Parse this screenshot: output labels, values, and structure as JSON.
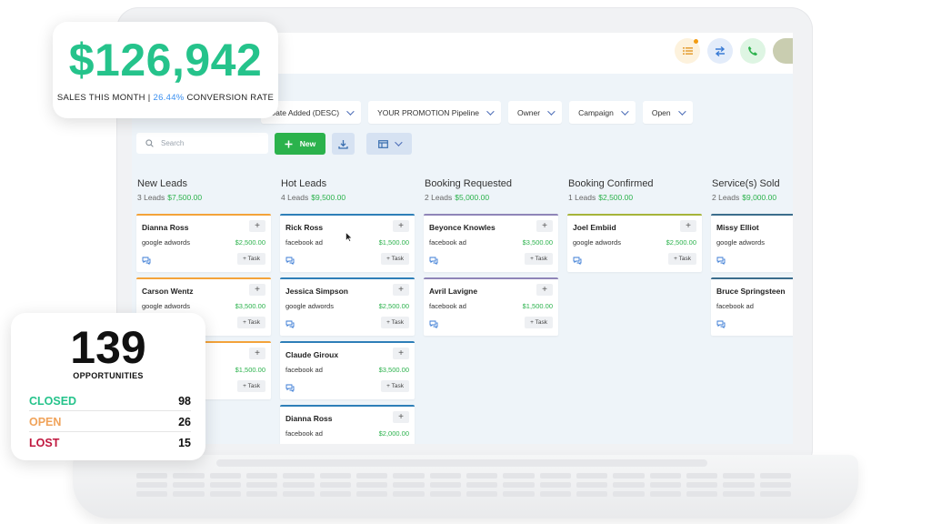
{
  "filters": [
    "Date Added (DESC)",
    "YOUR PROMOTION Pipeline",
    "Owner",
    "Campaign",
    "Open"
  ],
  "toolbar": {
    "search_placeholder": "Search",
    "new_label": "New"
  },
  "task_label": "+ Task",
  "add_label": "+",
  "columns": [
    {
      "title": "New Leads",
      "count": "3 Leads",
      "amount": "$7,500.00",
      "accent": "#f3a33a",
      "cards": [
        {
          "name": "Dianna Ross",
          "source": "google adwords",
          "value": "$2,500.00"
        },
        {
          "name": "Carson Wentz",
          "source": "google adwords",
          "value": "$3,500.00"
        },
        {
          "name": "",
          "source": "",
          "value": "$1,500.00"
        }
      ]
    },
    {
      "title": "Hot Leads",
      "count": "4 Leads",
      "amount": "$9,500.00",
      "accent": "#2e7fb8",
      "cards": [
        {
          "name": "Rick Ross",
          "source": "facebook ad",
          "value": "$1,500.00"
        },
        {
          "name": "Jessica Simpson",
          "source": "google adwords",
          "value": "$2,500.00"
        },
        {
          "name": "Claude Giroux",
          "source": "facebook ad",
          "value": "$3,500.00"
        },
        {
          "name": "Dianna Ross",
          "source": "facebook ad",
          "value": "$2,000.00"
        }
      ]
    },
    {
      "title": "Booking Requested",
      "count": "2 Leads",
      "amount": "$5,000.00",
      "accent": "#8f85b8",
      "cards": [
        {
          "name": "Beyonce Knowles",
          "source": "facebook ad",
          "value": "$3,500.00"
        },
        {
          "name": "Avril Lavigne",
          "source": "facebook ad",
          "value": "$1,500.00"
        }
      ]
    },
    {
      "title": "Booking Confirmed",
      "count": "1 Leads",
      "amount": "$2,500.00",
      "accent": "#a5b43a",
      "cards": [
        {
          "name": "Joel Embiid",
          "source": "google adwords",
          "value": "$2,500.00"
        }
      ]
    },
    {
      "title": "Service(s) Sold",
      "count": "2 Leads",
      "amount": "$9,000.00",
      "accent": "#3b6d8c",
      "cards": [
        {
          "name": "Missy Elliot",
          "source": "google adwords",
          "value": ""
        },
        {
          "name": "Bruce Springsteen",
          "source": "facebook ad",
          "value": ""
        }
      ]
    }
  ],
  "sales": {
    "amount": "$126,942",
    "label": "SALES THIS MONTH |",
    "rate": "26.44%",
    "rate_label": "CONVERSION RATE"
  },
  "opportunities": {
    "count": "139",
    "label": "OPPORTUNITIES",
    "rows": [
      {
        "label": "CLOSED",
        "value": "98",
        "color": "#25c38b"
      },
      {
        "label": "OPEN",
        "value": "26",
        "color": "#f0a35a"
      },
      {
        "label": "LOST",
        "value": "15",
        "color": "#c0183f"
      }
    ]
  },
  "icons": [
    "list-icon",
    "swap-icon",
    "phone-icon",
    "search-icon",
    "plus-icon",
    "download-icon",
    "columns-icon",
    "chat-icon",
    "chevron-down-icon",
    "cursor-icon"
  ]
}
